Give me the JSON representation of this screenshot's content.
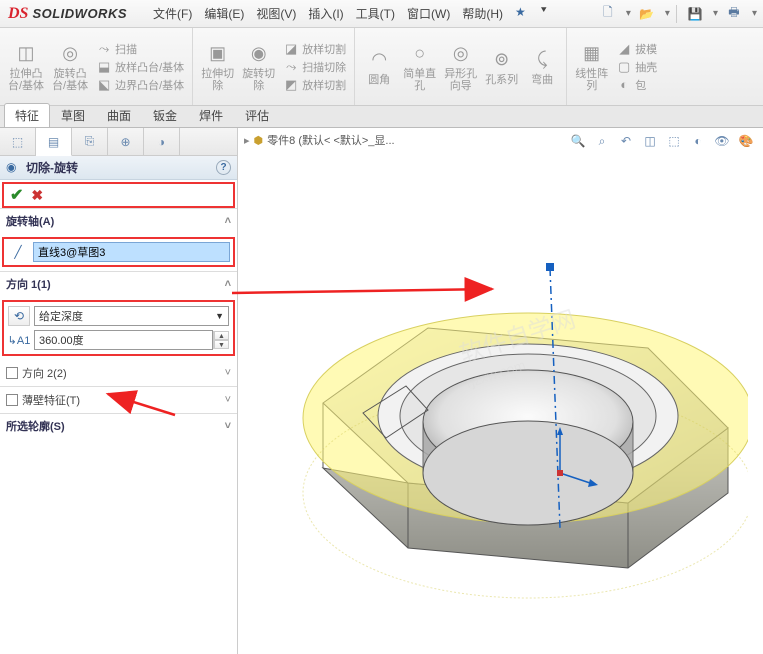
{
  "logo": {
    "icon": "DS",
    "text": "SOLIDWORKS"
  },
  "menu": {
    "file": "文件(F)",
    "edit": "编辑(E)",
    "view": "视图(V)",
    "insert": "插入(I)",
    "tools": "工具(T)",
    "window": "窗口(W)",
    "help": "帮助(H)",
    "star": "★"
  },
  "ribbon": {
    "g1": {
      "extrude": "拉伸凸\n台/基体",
      "revolve": "旋转凸\n台/基体",
      "sweep": "扫描",
      "loft": "放样凸台/基体",
      "boundary": "边界凸台/基体"
    },
    "g2": {
      "extcut": "拉伸切\n除",
      "revcut": "旋转切\n除",
      "loftcut": "放样切割",
      "sweepcut": "扫描切除",
      "boundcut": "放样切割"
    },
    "g3": {
      "fillet": "圆角",
      "simple": "简单直\n孔",
      "hole": "异形孔\n向导",
      "isohole": "孔系列",
      "bend": "弯曲"
    },
    "g4": {
      "linear": "线性阵\n列",
      "draft": "拔模",
      "shell": "抽壳",
      "mirror": "包"
    }
  },
  "tabs": {
    "features": "特征",
    "sketch": "草图",
    "surface": "曲面",
    "sheetmetal": "钣金",
    "weldments": "焊件",
    "evaluate": "评估"
  },
  "pm": {
    "title": "切除-旋转",
    "axis_head": "旋转轴(A)",
    "axis_value": "直线3@草图3",
    "dir1_head": "方向 1(1)",
    "dir1_type": "给定深度",
    "angle": "360.00度",
    "dir2": "方向 2(2)",
    "thin": "薄壁特征(T)",
    "contours": "所选轮廓(S)"
  },
  "breadcrumb": {
    "part": "零件8  (默认< <默认>_显..."
  }
}
